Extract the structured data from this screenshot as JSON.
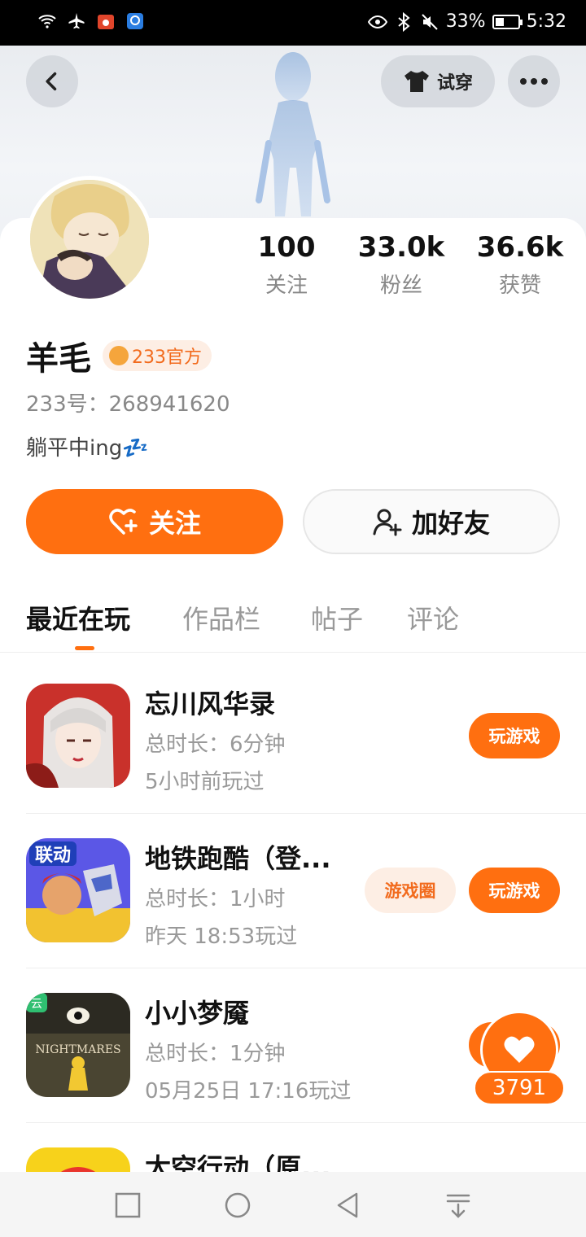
{
  "status_bar": {
    "battery_text": "33%",
    "time": "5:32"
  },
  "header": {
    "tryon_label": "试穿"
  },
  "stats": [
    {
      "num": "100",
      "label": "关注"
    },
    {
      "num": "33.0k",
      "label": "粉丝"
    },
    {
      "num": "36.6k",
      "label": "获赞"
    }
  ],
  "profile": {
    "name": "羊毛",
    "badge": "233官方",
    "uid": "233号：268941620",
    "bio": "躺平中ing💤"
  },
  "actions": {
    "follow_label": "关注",
    "add_friend_label": "加好友"
  },
  "tabs": [
    "最近在玩",
    "作品栏",
    "帖子",
    "评论"
  ],
  "games": [
    {
      "title": "忘川风华录",
      "duration": "总时长：6分钟",
      "last_played": "5小时前玩过",
      "play_label": "玩游戏"
    },
    {
      "title": "地铁跑酷（登...",
      "duration": "总时长：1小时",
      "last_played": "昨天 18:53玩过",
      "circle_label": "游戏圈",
      "play_label": "玩游戏"
    },
    {
      "title": "小小梦魇",
      "duration": "总时长：1分钟",
      "last_played": "05月25日 17:16玩过",
      "play_label": "玩游戏"
    },
    {
      "title": "太空行动（原..."
    }
  ],
  "game_icon_texts": {
    "subway_badge": "联动",
    "cloud_badge": "云",
    "nightmares_logo": "NIGHTMARES"
  },
  "like_float": {
    "count": "3791"
  },
  "colors": {
    "accent": "#ff6f10",
    "badge_bg": "#fdeee4"
  }
}
